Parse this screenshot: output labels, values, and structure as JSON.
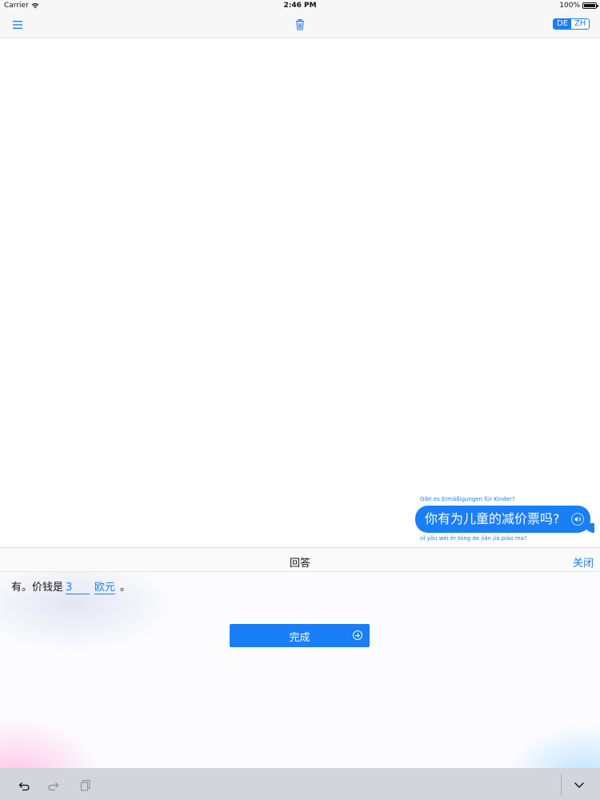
{
  "status_bar": {
    "carrier": "Carrier",
    "time": "2:46 PM",
    "battery": "100%",
    "battery_level": 1.0
  },
  "toolbar": {
    "menu_icon": "hamburger-menu-icon",
    "trash_icon": "trash-icon",
    "lang_de": "DE",
    "lang_zh": "ZH",
    "active_lang": "DE"
  },
  "chat": {
    "messages": [
      {
        "translation": "Gibt es Ermäßigungen für Kinder?",
        "text": "你有为儿童的减价票吗?",
        "pinyin": "nǐ yǒu wèi ér tóng de jiǎn jià piào ma?",
        "speaker_icon": "speaker-icon"
      }
    ]
  },
  "answer_panel": {
    "title": "回答",
    "close_label": "关闭",
    "sentence_prefix": "有。价钱是",
    "blank_number": "3",
    "blank_unit": "欧元",
    "sentence_suffix": "。",
    "done_label": "完成",
    "done_icon": "plus-circle-icon"
  },
  "shortcut_bar": {
    "undo_icon": "undo-icon",
    "redo_icon": "redo-icon",
    "paste_icon": "clipboard-icon",
    "dismiss_icon": "chevron-down-icon"
  },
  "colors": {
    "accent": "#1a7ef6",
    "toolbar_bg": "#f7f7f7",
    "keyboard_bar_bg": "#d2d5db"
  }
}
